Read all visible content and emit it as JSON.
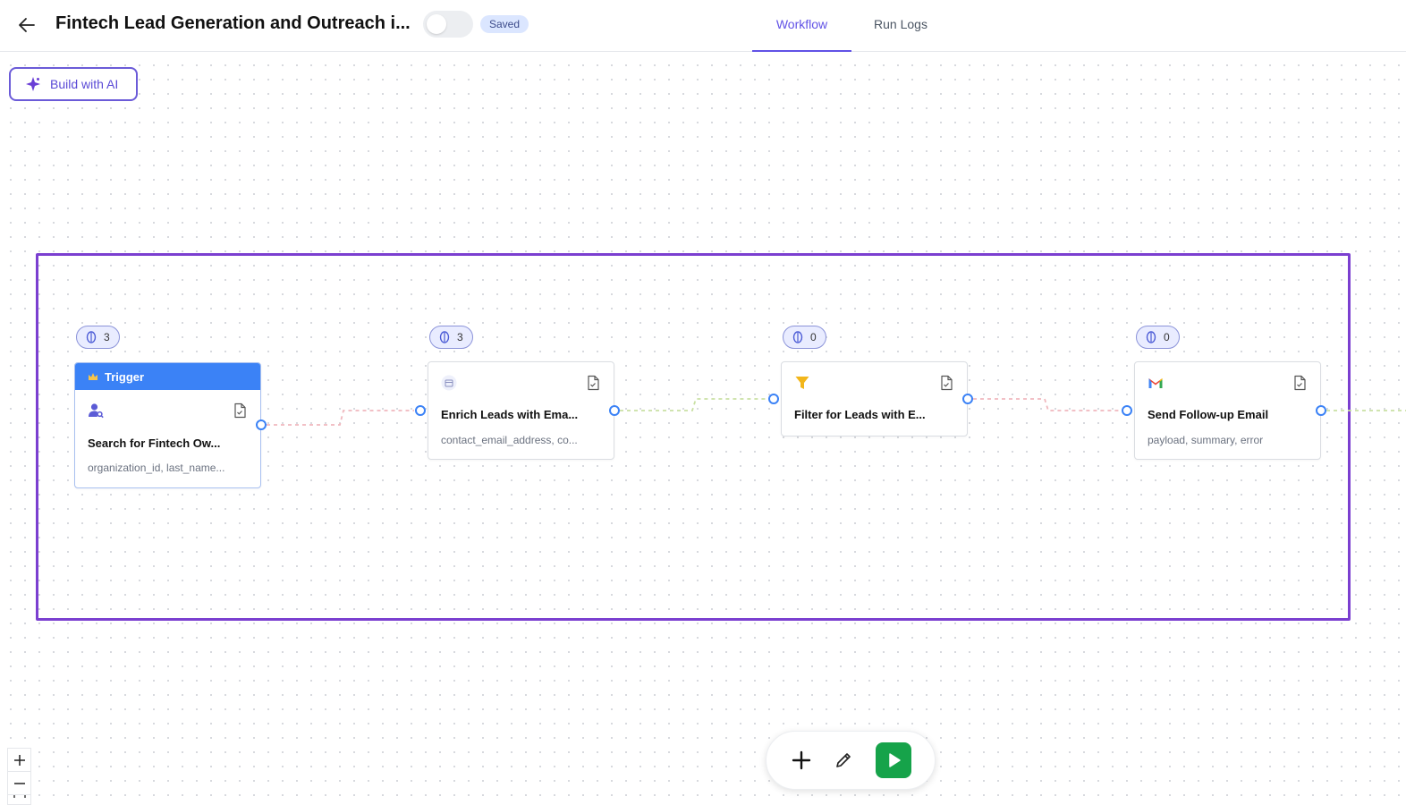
{
  "header": {
    "title": "Fintech Lead Generation and Outreach i...",
    "status_badge": "Saved",
    "tabs": [
      {
        "label": "Workflow",
        "active": true
      },
      {
        "label": "Run Logs",
        "active": false
      }
    ]
  },
  "canvas": {
    "build_ai_label": "Build with AI",
    "nodes": [
      {
        "badge_count": "3",
        "header": "Trigger",
        "title": "Search for Fintech Ow...",
        "subtitle": "organization_id, last_name..."
      },
      {
        "badge_count": "3",
        "title": "Enrich Leads with Ema...",
        "subtitle": "contact_email_address, co..."
      },
      {
        "badge_count": "0",
        "title": "Filter for Leads with E..."
      },
      {
        "badge_count": "0",
        "title": "Send Follow-up Email",
        "subtitle": "payload, summary, error"
      }
    ]
  },
  "colors": {
    "accent": "#6152e6",
    "trigger": "#3b82f6",
    "selection": "#7b3fd0",
    "run": "#16a34a"
  }
}
